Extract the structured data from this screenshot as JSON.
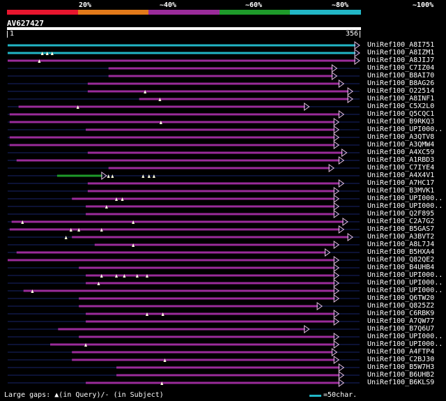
{
  "scale": {
    "labels": [
      "20%",
      "~40%",
      "~60%",
      "~80%",
      "~100%"
    ],
    "colors": [
      "#e8162e",
      "#e27a1a",
      "#9a2b9a",
      "#1e9a2a",
      "#22b6c6"
    ]
  },
  "query": {
    "title": "AV627427",
    "start": "1",
    "end": "356",
    "length": 356
  },
  "hits": [
    {
      "label": "UniRef100_A8I751",
      "color": "#22b6c6",
      "s": 0,
      "e": 356,
      "tri": true,
      "marks": []
    },
    {
      "label": "UniRef100_A8IZM1",
      "color": "#22b6c6",
      "s": 0,
      "e": 356,
      "tri": true,
      "marks": [
        35,
        40,
        45
      ]
    },
    {
      "label": "UniRef100_A8JIJ7",
      "color": "#9a2b9a",
      "s": 0,
      "e": 356,
      "tri": true,
      "marks": [
        32
      ]
    },
    {
      "label": "UniRef100_C7IZ04",
      "color": "#9a2b9a",
      "s": 102,
      "e": 333,
      "tri": true,
      "marks": []
    },
    {
      "label": "UniRef100_B8AI70",
      "color": "#9a2b9a",
      "s": 102,
      "e": 333,
      "tri": true,
      "marks": []
    },
    {
      "label": "UniRef100_B8AG26",
      "color": "#9a2b9a",
      "s": 81,
      "e": 340,
      "tri": true,
      "marks": []
    },
    {
      "label": "UniRef100_O22514",
      "color": "#9a2b9a",
      "s": 81,
      "e": 349,
      "tri": true,
      "marks": [
        139
      ]
    },
    {
      "label": "UniRef100_A8INF1",
      "color": "#9a2b9a",
      "s": 133,
      "e": 349,
      "tri": true,
      "marks": [
        154
      ]
    },
    {
      "label": "UniRef100_C5X2L0",
      "color": "#9a2b9a",
      "s": 11,
      "e": 305,
      "tri": true,
      "marks": [
        71
      ]
    },
    {
      "label": "UniRef100_Q5CQC1",
      "color": "#9a2b9a",
      "s": 2,
      "e": 340,
      "tri": true,
      "marks": []
    },
    {
      "label": "UniRef100_B9RKQ3",
      "color": "#9a2b9a",
      "s": 2,
      "e": 335,
      "tri": true,
      "marks": [
        155
      ]
    },
    {
      "label": "UniRef100_UPI000..",
      "color": "#9a2b9a",
      "s": 79,
      "e": 335,
      "tri": true,
      "marks": []
    },
    {
      "label": "UniRef100_A3QTV8",
      "color": "#9a2b9a",
      "s": 2,
      "e": 335,
      "tri": true,
      "marks": []
    },
    {
      "label": "UniRef100_A3QMW4",
      "color": "#9a2b9a",
      "s": 2,
      "e": 335,
      "tri": true,
      "marks": []
    },
    {
      "label": "UniRef100_A4XC59",
      "color": "#9a2b9a",
      "s": 81,
      "e": 343,
      "tri": true,
      "marks": []
    },
    {
      "label": "UniRef100_A1RBD3",
      "color": "#9a2b9a",
      "s": 9,
      "e": 340,
      "tri": true,
      "marks": []
    },
    {
      "label": "UniRef100_C7IYE4",
      "color": "#9a2b9a",
      "s": 102,
      "e": 330,
      "tri": true,
      "marks": []
    },
    {
      "label": "UniRef100_A4X4V1",
      "color": "#1e9a2a",
      "s": 50,
      "e": 100,
      "tri": true,
      "marks": [
        102,
        106,
        137,
        143,
        148
      ]
    },
    {
      "label": "UniRef100_A7HC17",
      "color": "#9a2b9a",
      "s": 81,
      "e": 340,
      "tri": true,
      "marks": []
    },
    {
      "label": "UniRef100_B3MVK1",
      "color": "#9a2b9a",
      "s": 81,
      "e": 335,
      "tri": true,
      "marks": []
    },
    {
      "label": "UniRef100_UPI000..",
      "color": "#9a2b9a",
      "s": 65,
      "e": 335,
      "tri": true,
      "marks": [
        110,
        116
      ]
    },
    {
      "label": "UniRef100_UPI000..",
      "color": "#9a2b9a",
      "s": 79,
      "e": 335,
      "tri": true,
      "marks": [
        100
      ]
    },
    {
      "label": "UniRef100_Q2F895",
      "color": "#9a2b9a",
      "s": 79,
      "e": 335,
      "tri": true,
      "marks": []
    },
    {
      "label": "UniRef100_C2A7G2",
      "color": "#9a2b9a",
      "s": 4,
      "e": 344,
      "tri": true,
      "marks": [
        15,
        127
      ]
    },
    {
      "label": "UniRef100_B5GAS7",
      "color": "#9a2b9a",
      "s": 2,
      "e": 340,
      "tri": true,
      "marks": [
        64,
        72,
        95
      ]
    },
    {
      "label": "UniRef100_A3BVT2",
      "color": "#9a2b9a",
      "s": 65,
      "e": 349,
      "tri": true,
      "marks": [
        59
      ]
    },
    {
      "label": "UniRef100_A8L7J4",
      "color": "#9a2b9a",
      "s": 88,
      "e": 335,
      "tri": true,
      "marks": [
        127
      ]
    },
    {
      "label": "UniRef100_B5HXA4",
      "color": "#9a2b9a",
      "s": 9,
      "e": 326,
      "tri": true,
      "marks": []
    },
    {
      "label": "UniRef100_Q82QE2",
      "color": "#9a2b9a",
      "s": 0,
      "e": 335,
      "tri": true,
      "marks": []
    },
    {
      "label": "UniRef100_B4UHB4",
      "color": "#9a2b9a",
      "s": 72,
      "e": 335,
      "tri": true,
      "marks": []
    },
    {
      "label": "UniRef100_UPI000..",
      "color": "#9a2b9a",
      "s": 79,
      "e": 335,
      "tri": true,
      "marks": [
        95,
        110,
        118,
        131,
        141
      ]
    },
    {
      "label": "UniRef100_UPI000..",
      "color": "#9a2b9a",
      "s": 79,
      "e": 335,
      "tri": true,
      "marks": [
        92
      ]
    },
    {
      "label": "UniRef100_UPI000..",
      "color": "#9a2b9a",
      "s": 16,
      "e": 335,
      "tri": true,
      "marks": [
        25
      ]
    },
    {
      "label": "UniRef100_Q6TW20",
      "color": "#9a2b9a",
      "s": 72,
      "e": 335,
      "tri": true,
      "marks": []
    },
    {
      "label": "UniRef100_Q825Z2",
      "color": "#9a2b9a",
      "s": 72,
      "e": 318,
      "tri": true,
      "marks": []
    },
    {
      "label": "UniRef100_C6RBK9",
      "color": "#9a2b9a",
      "s": 79,
      "e": 335,
      "tri": true,
      "marks": [
        141,
        157
      ]
    },
    {
      "label": "UniRef100_A7QW77",
      "color": "#9a2b9a",
      "s": 79,
      "e": 335,
      "tri": true,
      "marks": []
    },
    {
      "label": "UniRef100_B7Q6U7",
      "color": "#9a2b9a",
      "s": 51,
      "e": 305,
      "tri": true,
      "marks": []
    },
    {
      "label": "UniRef100_UPI000..",
      "color": "#9a2b9a",
      "s": 72,
      "e": 335,
      "tri": true,
      "marks": []
    },
    {
      "label": "UniRef100_UPI000..",
      "color": "#9a2b9a",
      "s": 43,
      "e": 335,
      "tri": true,
      "marks": [
        79
      ]
    },
    {
      "label": "UniRef100_A4FTP4",
      "color": "#9a2b9a",
      "s": 65,
      "e": 333,
      "tri": true,
      "marks": []
    },
    {
      "label": "UniRef100_C2BJ30",
      "color": "#9a2b9a",
      "s": 65,
      "e": 335,
      "tri": true,
      "marks": [
        159
      ]
    },
    {
      "label": "UniRef100_B5W7H3",
      "color": "#9a2b9a",
      "s": 110,
      "e": 340,
      "tri": true,
      "marks": []
    },
    {
      "label": "UniRef100_B6UHB2",
      "color": "#9a2b9a",
      "s": 110,
      "e": 340,
      "tri": true,
      "marks": []
    },
    {
      "label": "UniRef100_B6KLS9",
      "color": "#9a2b9a",
      "s": 79,
      "e": 340,
      "tri": true,
      "marks": [
        156
      ]
    }
  ],
  "footer": {
    "gaps_text": "Large gaps:",
    "query_gap": "(in Query)/",
    "subject_gap": "- (in Subject)",
    "legend_text": "=50char."
  }
}
